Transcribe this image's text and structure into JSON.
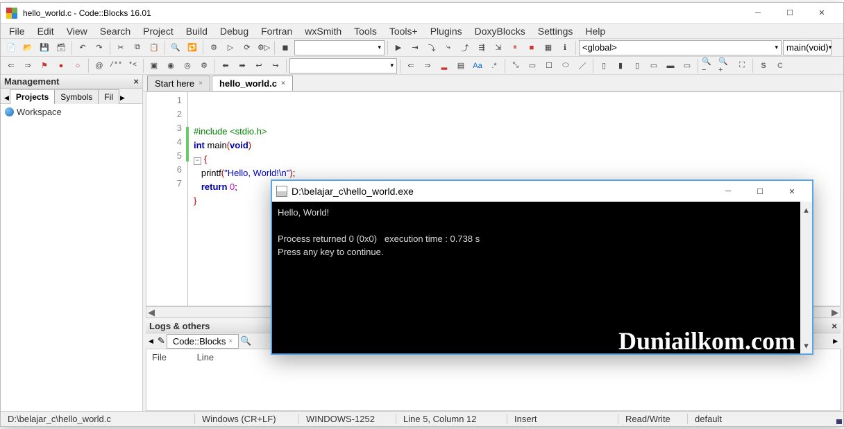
{
  "title": "hello_world.c - Code::Blocks 16.01",
  "menus": [
    "File",
    "Edit",
    "View",
    "Search",
    "Project",
    "Build",
    "Debug",
    "Fortran",
    "wxSmith",
    "Tools",
    "Tools+",
    "Plugins",
    "DoxyBlocks",
    "Settings",
    "Help"
  ],
  "toolbar_combos": {
    "scope": "<global>",
    "func": "main(void)"
  },
  "management": {
    "title": "Management",
    "tabs": [
      "Projects",
      "Symbols",
      "Fil"
    ],
    "active": 0,
    "tree_root": "Workspace"
  },
  "editor_tabs": [
    {
      "label": "Start here",
      "active": false
    },
    {
      "label": "hello_world.c",
      "active": true
    }
  ],
  "code_lines": [
    {
      "n": 1,
      "segs": [
        {
          "t": "pre",
          "v": "#include <stdio.h>"
        }
      ]
    },
    {
      "n": 2,
      "segs": [
        {
          "t": "kw",
          "v": "int"
        },
        {
          "t": "",
          "v": " main"
        },
        {
          "t": "pn",
          "v": "("
        },
        {
          "t": "kw",
          "v": "void"
        },
        {
          "t": "pn",
          "v": ")"
        }
      ]
    },
    {
      "n": 3,
      "fold": true,
      "segs": [
        {
          "t": "pn",
          "v": "{"
        }
      ]
    },
    {
      "n": 4,
      "segs": [
        {
          "t": "",
          "v": "   printf"
        },
        {
          "t": "pn",
          "v": "("
        },
        {
          "t": "str",
          "v": "\"Hello, World!\\n\""
        },
        {
          "t": "pn",
          "v": ")"
        },
        {
          "t": "",
          "v": ";"
        }
      ]
    },
    {
      "n": 5,
      "segs": [
        {
          "t": "",
          "v": "   "
        },
        {
          "t": "kw",
          "v": "return"
        },
        {
          "t": "",
          "v": " "
        },
        {
          "t": "num",
          "v": "0"
        },
        {
          "t": "",
          "v": ";"
        }
      ]
    },
    {
      "n": 6,
      "segs": [
        {
          "t": "pn",
          "v": "}"
        }
      ]
    },
    {
      "n": 7,
      "segs": [
        {
          "t": "",
          "v": ""
        }
      ]
    }
  ],
  "logs": {
    "title": "Logs & others",
    "tab": "Code::Blocks",
    "headers": [
      "File",
      "Line"
    ]
  },
  "status": {
    "path": "D:\\belajar_c\\hello_world.c",
    "eol": "Windows (CR+LF)",
    "enc": "WINDOWS-1252",
    "pos": "Line 5, Column 12",
    "ins": "Insert",
    "rw": "Read/Write",
    "lang": "default"
  },
  "console": {
    "title": "D:\\belajar_c\\hello_world.exe",
    "lines": [
      "Hello, World!",
      "",
      "Process returned 0 (0x0)   execution time : 0.738 s",
      "Press any key to continue."
    ],
    "watermark": "Duniailkom.com"
  }
}
